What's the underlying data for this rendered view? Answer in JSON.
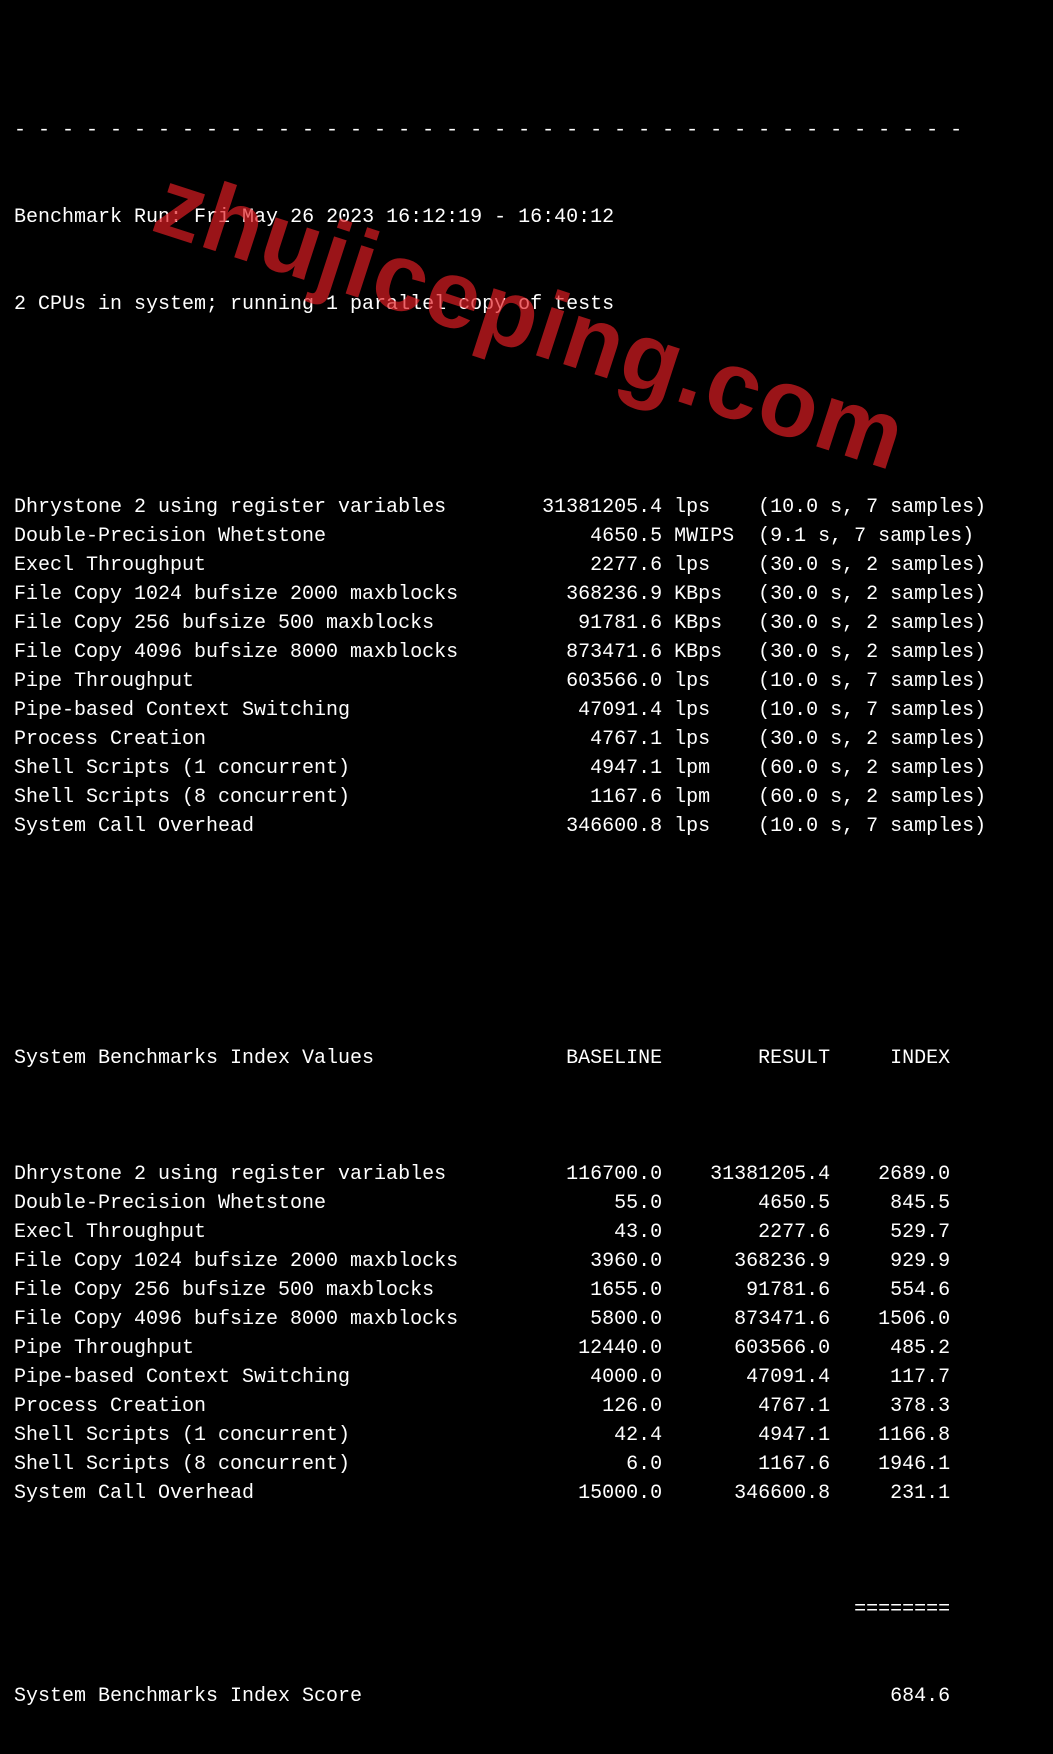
{
  "watermark": "zhujiceping.com",
  "dashes_top": "- - - - - - - - - - - - - - - - - - - - - - - - - - - - - - - - - - - - - - - -",
  "header": {
    "run_label": "Benchmark Run:",
    "run_time": "Fri May 26 2023 16:12:19 - 16:40:12",
    "system_line": "2 CPUs in system; running 1 parallel copy of tests"
  },
  "tests": [
    {
      "name": "Dhrystone 2 using register variables",
      "value": "31381205.4",
      "unit": "lps",
      "timing": "(10.0 s, 7 samples)"
    },
    {
      "name": "Double-Precision Whetstone",
      "value": "4650.5",
      "unit": "MWIPS",
      "timing": "(9.1 s, 7 samples)"
    },
    {
      "name": "Execl Throughput",
      "value": "2277.6",
      "unit": "lps",
      "timing": "(30.0 s, 2 samples)"
    },
    {
      "name": "File Copy 1024 bufsize 2000 maxblocks",
      "value": "368236.9",
      "unit": "KBps",
      "timing": "(30.0 s, 2 samples)"
    },
    {
      "name": "File Copy 256 bufsize 500 maxblocks",
      "value": "91781.6",
      "unit": "KBps",
      "timing": "(30.0 s, 2 samples)"
    },
    {
      "name": "File Copy 4096 bufsize 8000 maxblocks",
      "value": "873471.6",
      "unit": "KBps",
      "timing": "(30.0 s, 2 samples)"
    },
    {
      "name": "Pipe Throughput",
      "value": "603566.0",
      "unit": "lps",
      "timing": "(10.0 s, 7 samples)"
    },
    {
      "name": "Pipe-based Context Switching",
      "value": "47091.4",
      "unit": "lps",
      "timing": "(10.0 s, 7 samples)"
    },
    {
      "name": "Process Creation",
      "value": "4767.1",
      "unit": "lps",
      "timing": "(30.0 s, 2 samples)"
    },
    {
      "name": "Shell Scripts (1 concurrent)",
      "value": "4947.1",
      "unit": "lpm",
      "timing": "(60.0 s, 2 samples)"
    },
    {
      "name": "Shell Scripts (8 concurrent)",
      "value": "1167.6",
      "unit": "lpm",
      "timing": "(60.0 s, 2 samples)"
    },
    {
      "name": "System Call Overhead",
      "value": "346600.8",
      "unit": "lps",
      "timing": "(10.0 s, 7 samples)"
    }
  ],
  "index_header": {
    "title": "System Benchmarks Index Values",
    "baseline": "BASELINE",
    "result": "RESULT",
    "index": "INDEX"
  },
  "index_rows": [
    {
      "name": "Dhrystone 2 using register variables",
      "baseline": "116700.0",
      "result": "31381205.4",
      "index": "2689.0"
    },
    {
      "name": "Double-Precision Whetstone",
      "baseline": "55.0",
      "result": "4650.5",
      "index": "845.5"
    },
    {
      "name": "Execl Throughput",
      "baseline": "43.0",
      "result": "2277.6",
      "index": "529.7"
    },
    {
      "name": "File Copy 1024 bufsize 2000 maxblocks",
      "baseline": "3960.0",
      "result": "368236.9",
      "index": "929.9"
    },
    {
      "name": "File Copy 256 bufsize 500 maxblocks",
      "baseline": "1655.0",
      "result": "91781.6",
      "index": "554.6"
    },
    {
      "name": "File Copy 4096 bufsize 8000 maxblocks",
      "baseline": "5800.0",
      "result": "873471.6",
      "index": "1506.0"
    },
    {
      "name": "Pipe Throughput",
      "baseline": "12440.0",
      "result": "603566.0",
      "index": "485.2"
    },
    {
      "name": "Pipe-based Context Switching",
      "baseline": "4000.0",
      "result": "47091.4",
      "index": "117.7"
    },
    {
      "name": "Process Creation",
      "baseline": "126.0",
      "result": "4767.1",
      "index": "378.3"
    },
    {
      "name": "Shell Scripts (1 concurrent)",
      "baseline": "42.4",
      "result": "4947.1",
      "index": "1166.8"
    },
    {
      "name": "Shell Scripts (8 concurrent)",
      "baseline": "6.0",
      "result": "1167.6",
      "index": "1946.1"
    },
    {
      "name": "System Call Overhead",
      "baseline": "15000.0",
      "result": "346600.8",
      "index": "231.1"
    }
  ],
  "divider": "========",
  "score_label": "System Benchmarks Index Score",
  "score_value": "684.6"
}
